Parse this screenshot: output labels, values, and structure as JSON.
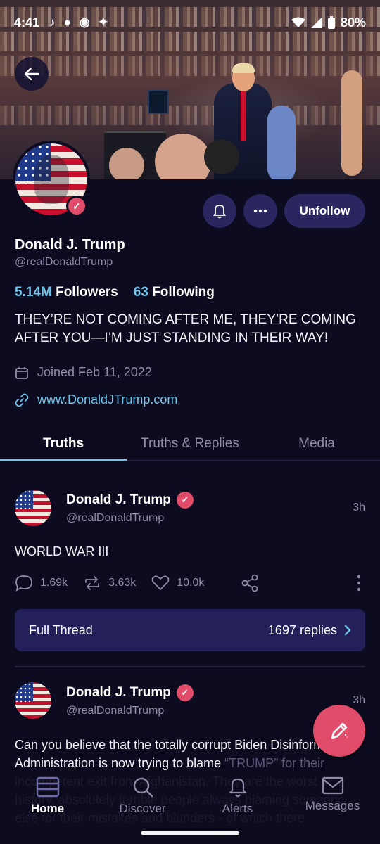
{
  "status_bar": {
    "time": "4:41",
    "battery": "80%",
    "app_icons": [
      "tiktok-icon",
      "reddit-icon",
      "spotify-icon",
      "twitter-icon"
    ]
  },
  "profile": {
    "display_name": "Donald J. Trump",
    "handle": "@realDonaldTrump",
    "followers_count": "5.14M",
    "followers_label": "Followers",
    "following_count": "63",
    "following_label": "Following",
    "bio": "THEY’RE NOT COMING AFTER ME, THEY’RE COMING AFTER YOU—I’M JUST STANDING IN THEIR WAY!",
    "joined": "Joined Feb 11, 2022",
    "website": "www.DonaldJTrump.com",
    "unfollow_label": "Unfollow"
  },
  "tabs": [
    {
      "label": "Truths",
      "active": true
    },
    {
      "label": "Truths & Replies",
      "active": false
    },
    {
      "label": "Media",
      "active": false
    }
  ],
  "posts": [
    {
      "name": "Donald J. Trump",
      "handle": "@realDonaldTrump",
      "time": "3h",
      "text": "WORLD WAR III",
      "replies": "1.69k",
      "retruths": "3.63k",
      "likes": "10.0k",
      "thread_label": "Full Thread",
      "thread_replies": "1697 replies"
    },
    {
      "name": "Donald J. Trump",
      "handle": "@realDonaldTrump",
      "time": "3h",
      "text_visible": "Can you believe that the totally corrupt Biden Disinformation Administration is now trying to blame",
      "text_faded": "“TRUMP” for their incompetent exit from Afghanistan. They are the worst in history, absolutely terrible people always blaming someone else for their mistakes and blunders - of which there"
    }
  ],
  "bottom_nav": [
    {
      "label": "Home",
      "active": true,
      "icon": "home-icon"
    },
    {
      "label": "Discover",
      "active": false,
      "icon": "search-icon"
    },
    {
      "label": "Alerts",
      "active": false,
      "icon": "bell-icon"
    },
    {
      "label": "Messages",
      "active": false,
      "icon": "mail-icon"
    }
  ],
  "colors": {
    "background": "#0d0b1f",
    "accent_blue": "#6ec4ea",
    "button_bg": "#2a2760",
    "verified_pink": "#e24c6b",
    "thread_bg": "#23205a"
  }
}
